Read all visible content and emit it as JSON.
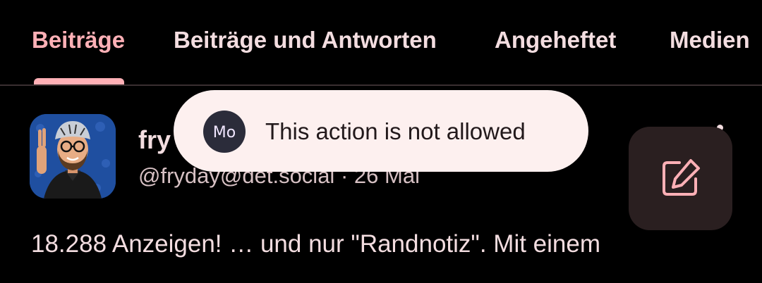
{
  "tabs": [
    {
      "label": "Beiträge",
      "active": true
    },
    {
      "label": "Beiträge und Antworten",
      "active": false
    },
    {
      "label": "Angeheftet",
      "active": false
    },
    {
      "label": "Medien",
      "active": false
    }
  ],
  "post": {
    "display_name": "fry",
    "handle": "@fryday@det.social",
    "separator": "·",
    "date": "26 Mai",
    "text": "18.288 Anzeigen! … und nur \"Randnotiz\". Mit einem"
  },
  "toast": {
    "app_icon_text": "Mo",
    "message": "This action is not allowed"
  },
  "fab": {
    "icon": "edit-icon"
  },
  "colors": {
    "accent": "#ffb0b6",
    "background": "#000000",
    "text": "#f3dde0",
    "toast_bg": "#fdf0ef",
    "fab_bg": "#2a1f20"
  }
}
